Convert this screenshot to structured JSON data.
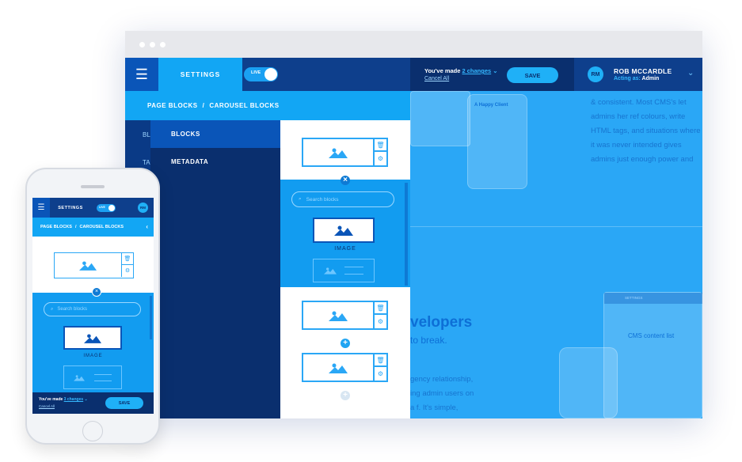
{
  "desktop": {
    "topbar": {
      "settings_label": "SETTINGS",
      "live_label": "LIVE",
      "changes_prefix": "You've made ",
      "changes_link": "2 changes",
      "cancel_all": "Cancel All",
      "save_label": "SAVE",
      "user_initials": "RM",
      "user_name": "ROB MCCARDLE",
      "acting_as_label": "Acting as:",
      "acting_as_value": "Admin"
    },
    "breadcrumb": {
      "parent": "PAGE BLOCKS",
      "separator": "/",
      "current": "CAROUSEL BLOCKS"
    },
    "nav_narrow": [
      "BL",
      "TA"
    ],
    "nav": [
      {
        "label": "BLOCKS"
      },
      {
        "label": "METADATA"
      }
    ],
    "blocks_panel": {
      "search_placeholder": "Search blocks",
      "image_caption": "IMAGE"
    },
    "background_site": {
      "paragraph": "& consistent. Most CMS's let admins her ref colours, write HTML tags, and situations where it was never intended gives admins just enough power and",
      "card_title": "A Happy Client",
      "heading": "velopers",
      "subheading": "to break.",
      "body": "gency relationship, ing admin users on a f. It's simple, focused mins pick fonts, add",
      "mini_app_title": "CMS content list",
      "mini_app_tab": "SETTINGS"
    }
  },
  "mobile": {
    "settings_label": "SETTINGS",
    "live_label": "LIVE",
    "avatar": "RM",
    "breadcrumb_parent": "PAGE BLOCKS",
    "breadcrumb_separator": "/",
    "breadcrumb_current": "CAROUSEL BLOCKS",
    "search_placeholder": "Search blocks",
    "image_caption": "IMAGE",
    "changes_prefix": "You've made ",
    "changes_link": "3 changes",
    "cancel_all": "Cancel All",
    "save_label": "SAVE"
  },
  "colors": {
    "navy": "#0a2f6e",
    "blue": "#0e3f8c",
    "accent": "#12a6f4",
    "sky": "#2aa7f6"
  }
}
